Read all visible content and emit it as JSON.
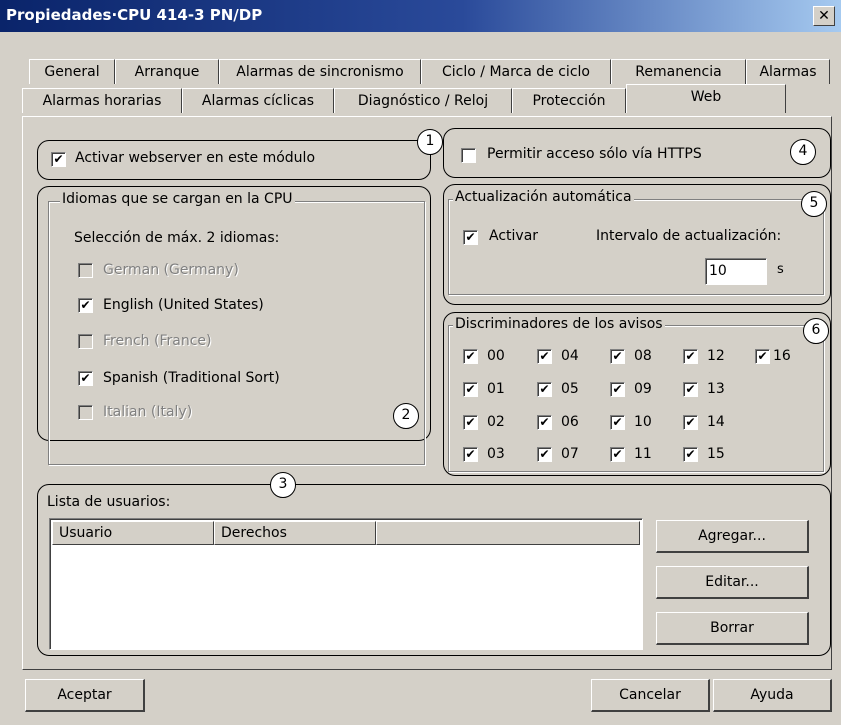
{
  "window": {
    "title": "Propiedades·CPU 414-3 PN/DP",
    "close": "✕"
  },
  "tabs": {
    "row1": [
      "General",
      "Arranque",
      "Alarmas de sincronismo",
      "Ciclo / Marca de ciclo",
      "Remanencia",
      "Alarmas"
    ],
    "row2": [
      "Alarmas horarias",
      "Alarmas cíclicas",
      "Diagnóstico / Reloj",
      "Protección",
      "Web"
    ],
    "active": "Web"
  },
  "callouts": [
    "1",
    "2",
    "3",
    "4",
    "5",
    "6"
  ],
  "webserver": {
    "label": "Activar webserver en este módulo",
    "checked": true
  },
  "https": {
    "label": "Permitir acceso sólo vía HTTPS",
    "checked": false
  },
  "languages": {
    "title": "Idiomas que se cargan en la CPU",
    "subtitle": "Selección de máx. 2 idiomas:",
    "items": [
      {
        "label": "German (Germany)",
        "checked": false,
        "enabled": false
      },
      {
        "label": "English (United States)",
        "checked": true,
        "enabled": true
      },
      {
        "label": "French (France)",
        "checked": false,
        "enabled": false
      },
      {
        "label": "Spanish (Traditional Sort)",
        "checked": true,
        "enabled": true
      },
      {
        "label": "Italian (Italy)",
        "checked": false,
        "enabled": false
      }
    ]
  },
  "autoupdate": {
    "title": "Actualización automática",
    "activate_label": "Activar",
    "activate_checked": true,
    "interval_label": "Intervalo de actualización:",
    "interval_value": "10",
    "unit": "s"
  },
  "discriminators": {
    "title": "Discriminadores de los avisos",
    "items": [
      "00",
      "01",
      "02",
      "03",
      "04",
      "05",
      "06",
      "07",
      "08",
      "09",
      "10",
      "11",
      "12",
      "13",
      "14",
      "15",
      "16"
    ],
    "check": "✔"
  },
  "users": {
    "title": "Lista de usuarios:",
    "columns": [
      "Usuario",
      "Derechos",
      ""
    ],
    "add": "Agregar...",
    "edit": "Editar...",
    "delete": "Borrar"
  },
  "footer": {
    "ok": "Aceptar",
    "cancel": "Cancelar",
    "help": "Ayuda"
  }
}
